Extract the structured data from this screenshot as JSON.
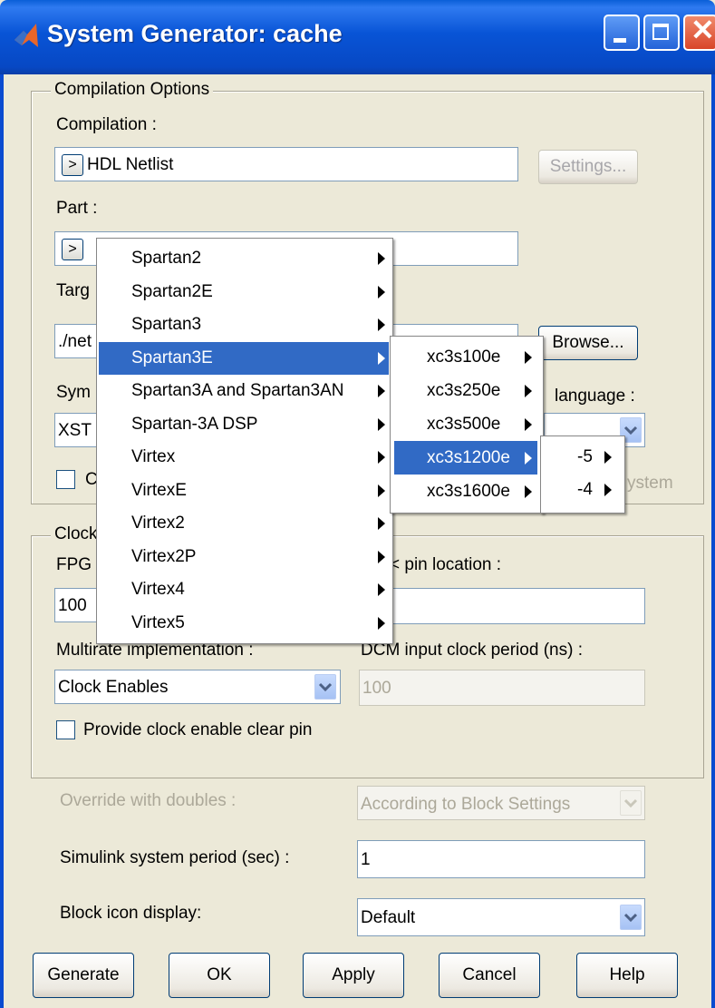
{
  "window": {
    "title": "System Generator: cache"
  },
  "compilation_options": {
    "group_title": "Compilation Options",
    "compilation_label": "Compilation :",
    "compilation_button": ">",
    "compilation_value": "HDL Netlist",
    "settings_button": "Settings...",
    "part_label": "Part :",
    "part_button": ">",
    "target_label_partial": "Targ",
    "target_value_partial": "./net",
    "browse_button": "Browse...",
    "synth_label_partial": "Sym",
    "hdl_label_partial": "language :",
    "synth_value_partial": "XST",
    "create_partial": "C",
    "testbench_partial": "ystem"
  },
  "clocking": {
    "group_title_partial": "Clock",
    "fpga_label_partial": "FPG",
    "clock_pin_label_partial": "< pin location :",
    "fpga_value_partial": "100",
    "multirate_label_partial": "Multirate implementation :",
    "dcm_label_partial": "DCM input clock period (ns) :",
    "multirate_value": "Clock Enables",
    "dcm_value": "100",
    "clear_pin_label": "Provide clock enable clear pin"
  },
  "options": {
    "override_label": "Override with doubles :",
    "override_value": "According to Block Settings",
    "period_label": "Simulink system period (sec) :",
    "period_value": "1",
    "icon_display_label": "Block icon display:",
    "icon_display_value": "Default"
  },
  "buttons": {
    "generate": "Generate",
    "ok": "OK",
    "apply": "Apply",
    "cancel": "Cancel",
    "help": "Help"
  },
  "family_menu": {
    "items": [
      "Spartan2",
      "Spartan2E",
      "Spartan3",
      "Spartan3E",
      "Spartan3A and Spartan3AN",
      "Spartan-3A DSP",
      "Virtex",
      "VirtexE",
      "Virtex2",
      "Virtex2P",
      "Virtex4",
      "Virtex5"
    ],
    "selected": "Spartan3E"
  },
  "device_menu": {
    "items": [
      "xc3s100e",
      "xc3s250e",
      "xc3s500e",
      "xc3s1200e",
      "xc3s1600e"
    ],
    "selected": "xc3s1200e"
  },
  "speed_menu": {
    "items": [
      "-5",
      "-4"
    ]
  },
  "colors": {
    "title_bar": "#0854d6",
    "dialog_bg": "#ece9d8",
    "menu_highlight": "#316ac5"
  },
  "icons": {
    "app": "matlab-logo-icon",
    "minimize": "minimize-icon",
    "maximize": "maximize-icon",
    "close": "close-icon"
  }
}
